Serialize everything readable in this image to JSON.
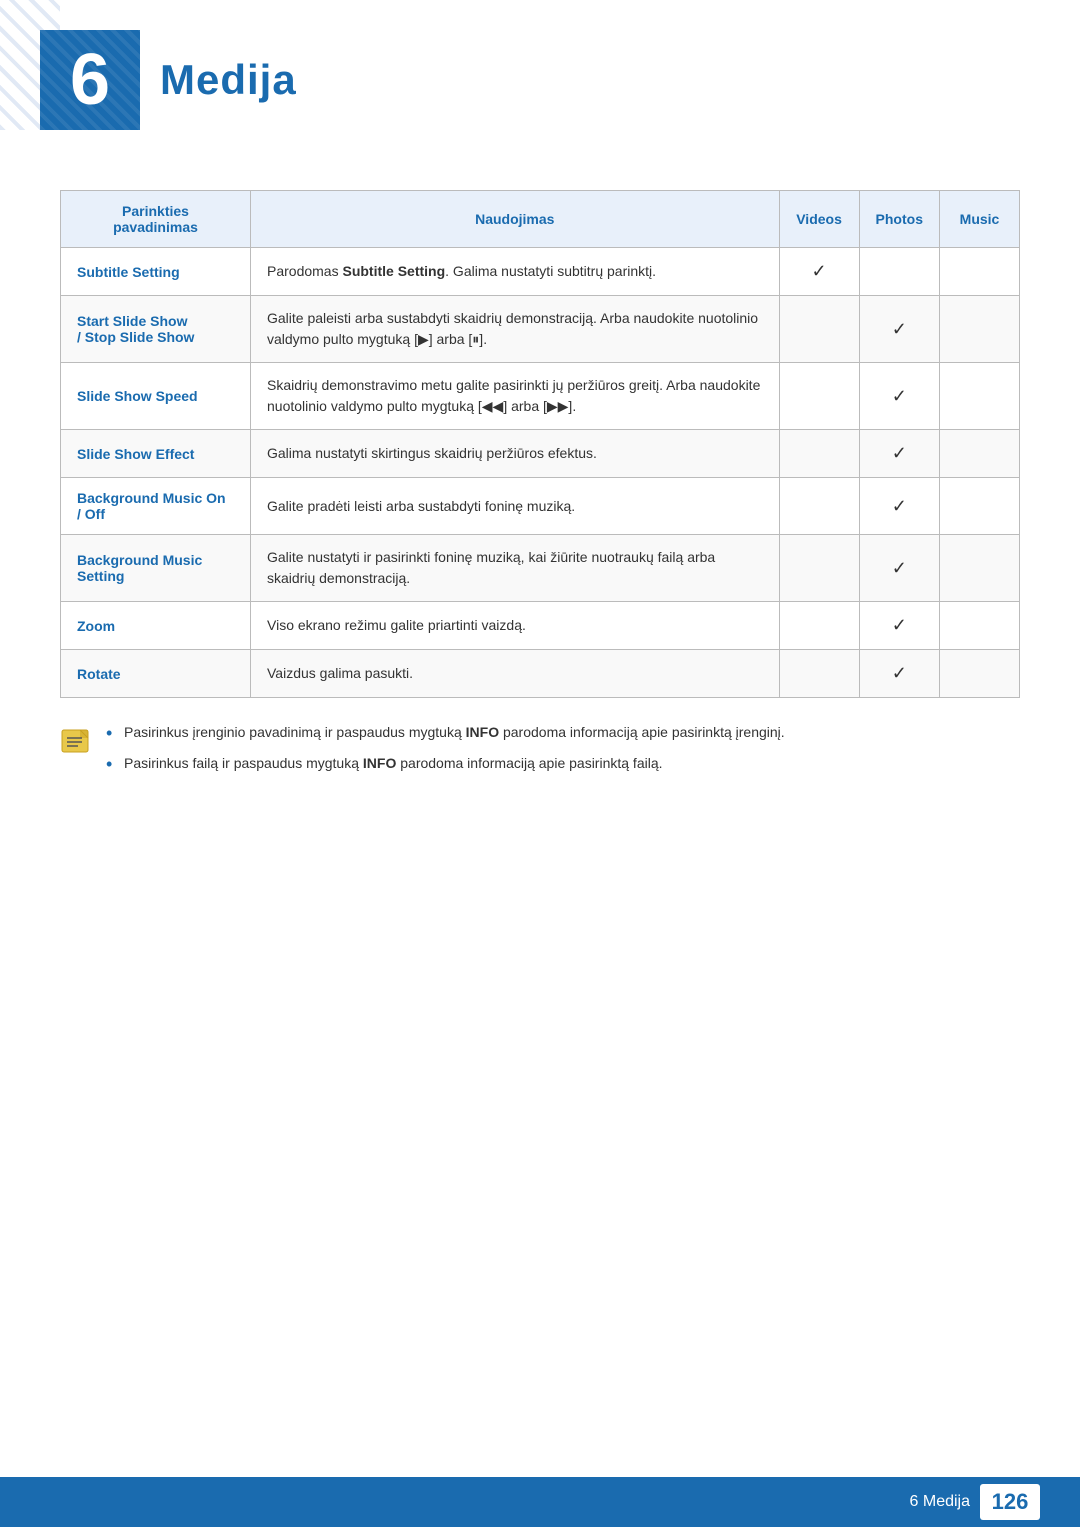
{
  "header": {
    "chapter_number": "6",
    "title": "Medija"
  },
  "table": {
    "columns": {
      "parinkties": "Parinkties\npavadinimas",
      "naudojimas": "Naudojimas",
      "videos": "Videos",
      "photos": "Photos",
      "music": "Music"
    },
    "rows": [
      {
        "label": "Subtitle Setting",
        "description": "Parodomas <strong>Subtitle Setting</strong>. Galima nustatyti subtitrų parinktį.",
        "videos": true,
        "photos": false,
        "music": false
      },
      {
        "label": "Start Slide Show / Stop Slide Show",
        "description": "Galite paleisti arba sustabdyti skaidrių demonstraciją. Arba naudokite nuotolinio valdymo pulto mygtuką [▶] arba [⏸].",
        "videos": false,
        "photos": true,
        "music": false
      },
      {
        "label": "Slide Show Speed",
        "description": "Skaidrių demonstravimo metu galite pasirinkti jų peržiūros greitį. Arba naudokite nuotolinio valdymo pulto mygtuką [◀◀] arba [▶▶].",
        "videos": false,
        "photos": true,
        "music": false
      },
      {
        "label": "Slide Show Effect",
        "description": "Galima nustatyti skirtingus skaidrių peržiūros efektus.",
        "videos": false,
        "photos": true,
        "music": false
      },
      {
        "label": "Background Music On / Off",
        "description": "Galite pradėti leisti arba sustabdyti foninę muziką.",
        "videos": false,
        "photos": true,
        "music": false
      },
      {
        "label": "Background Music Setting",
        "description": "Galite nustatyti ir pasirinkti foninę muziką, kai žiūrite nuotraukų failą arba skaidrių demonstraciją.",
        "videos": false,
        "photos": true,
        "music": false
      },
      {
        "label": "Zoom",
        "description": "Viso ekrano režimu galite priartinti vaizdą.",
        "videos": false,
        "photos": true,
        "music": false
      },
      {
        "label": "Rotate",
        "description": "Vaizdus galima pasukti.",
        "videos": false,
        "photos": true,
        "music": false
      }
    ]
  },
  "notes": [
    "Pasirinkus įrenginio pavadinimą ir paspaudus mygtuką <strong>INFO</strong> parodoma informaciją apie pasirinktą įrenginį.",
    "Pasirinkus failą ir paspaudus mygtuką <strong>INFO</strong> parodoma informaciją apie pasirinktą failą."
  ],
  "footer": {
    "chapter_label": "6 Medija",
    "page_number": "126"
  }
}
